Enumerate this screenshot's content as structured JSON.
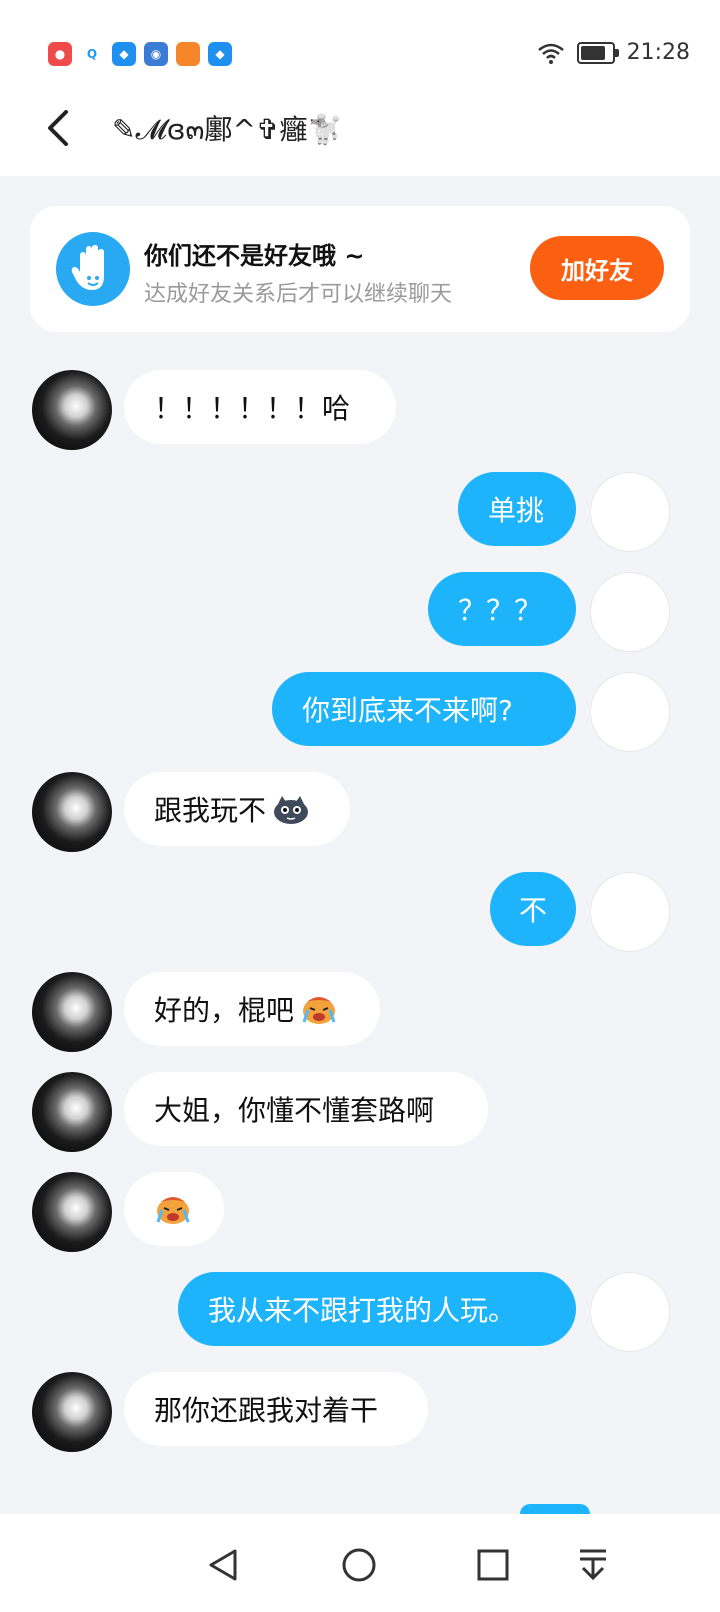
{
  "status_bar": {
    "time": "21:28",
    "app_icons": [
      "photo-app-icon",
      "qq-icon",
      "shield-app-icon",
      "robot-app-icon",
      "orange-app-icon",
      "shield-app-icon"
    ]
  },
  "header": {
    "title": "✎𝓜ɞ๓鄽^✞癰🐩"
  },
  "banner": {
    "title": "你们还不是好友哦 ~",
    "subtitle": "达成好友关系后才可以继续聊天",
    "add_button": "加好友"
  },
  "messages": [
    {
      "side": "in",
      "text": "！！！！！！哈"
    },
    {
      "side": "out",
      "text": "单挑"
    },
    {
      "side": "out",
      "text": "？？？"
    },
    {
      "side": "out",
      "text": "你到底来不来啊?"
    },
    {
      "side": "in",
      "text": "跟我玩不",
      "emoji": "dark-face-emoji"
    },
    {
      "side": "out",
      "text": "不"
    },
    {
      "side": "in",
      "text": "好的，棍吧",
      "emoji": "crying-emoji"
    },
    {
      "side": "in",
      "text": "大姐，你懂不懂套路啊"
    },
    {
      "side": "in",
      "text": "",
      "emoji": "crying-emoji"
    },
    {
      "side": "out",
      "text": "我从来不跟打我的人玩。"
    },
    {
      "side": "in",
      "text": "那你还跟我对着干"
    }
  ],
  "colors": {
    "accent_blue": "#1eb4fb",
    "add_button_orange": "#fb6012",
    "background": "#f2f4f7"
  },
  "bottom_nav": [
    "back-icon",
    "home-icon",
    "recents-icon",
    "notification-pull-icon"
  ]
}
